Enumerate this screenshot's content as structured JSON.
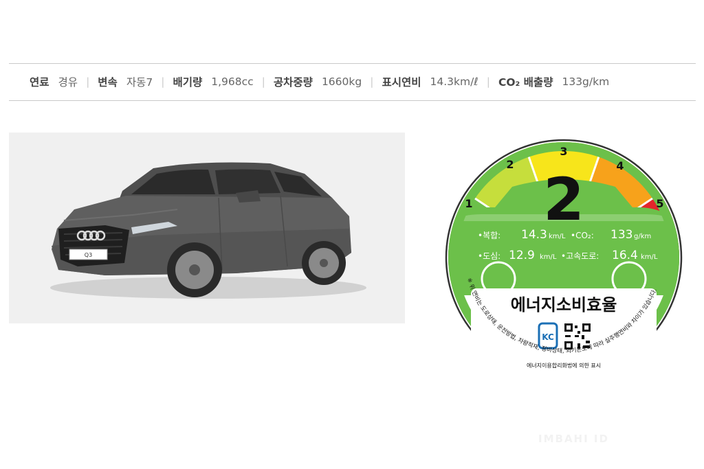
{
  "specs": [
    {
      "label": "연료",
      "value": "경유"
    },
    {
      "label": "변속",
      "value": "자동7"
    },
    {
      "label": "배기량",
      "value": "1,968cc"
    },
    {
      "label": "공차중량",
      "value": "1660kg"
    },
    {
      "label": "표시연비",
      "value": "14.3km/ℓ"
    },
    {
      "label": "CO₂ 배출량",
      "value": "133g/km"
    }
  ],
  "car": {
    "plate_text": "Q3"
  },
  "energy_label": {
    "grade_scale": [
      "1",
      "2",
      "3",
      "4",
      "5"
    ],
    "grade": "2",
    "combined_label": "•복합:",
    "combined_value": "14.3",
    "combined_unit": "km/L",
    "co2_label": "•CO₂:",
    "co2_value": "133",
    "co2_unit": "g/km",
    "city_label": "•도심:",
    "city_value": "12.9",
    "city_unit": "km/L",
    "highway_label": "•고속도로:",
    "highway_value": "16.4",
    "highway_unit": "km/L",
    "title": "에너지소비효율",
    "disclaimer": "※ 위 연비는 도로상태, 운전방법, 차량적재, 정비상태, 외기온도에 따라 실주행연비와 차이가 있습니다.",
    "footer": "에너지이용합리화법에 의한 표시",
    "certification_mark": "KC",
    "colors": {
      "green": "#6cc04a",
      "yellow_green": "#c6de3c",
      "yellow": "#f7e51b",
      "orange": "#f7a21b",
      "red": "#e3262b",
      "text": "#111111",
      "kc_blue": "#1b6fb5"
    }
  },
  "watermark_text": "IMBAHI ID"
}
